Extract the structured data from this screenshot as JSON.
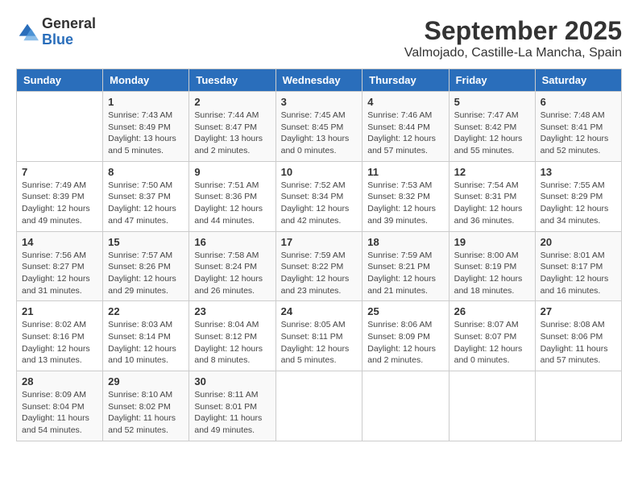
{
  "logo": {
    "general": "General",
    "blue": "Blue"
  },
  "header": {
    "month": "September 2025",
    "location": "Valmojado, Castille-La Mancha, Spain"
  },
  "days_of_week": [
    "Sunday",
    "Monday",
    "Tuesday",
    "Wednesday",
    "Thursday",
    "Friday",
    "Saturday"
  ],
  "weeks": [
    [
      {
        "num": "",
        "info": ""
      },
      {
        "num": "1",
        "info": "Sunrise: 7:43 AM\nSunset: 8:49 PM\nDaylight: 13 hours\nand 5 minutes."
      },
      {
        "num": "2",
        "info": "Sunrise: 7:44 AM\nSunset: 8:47 PM\nDaylight: 13 hours\nand 2 minutes."
      },
      {
        "num": "3",
        "info": "Sunrise: 7:45 AM\nSunset: 8:45 PM\nDaylight: 13 hours\nand 0 minutes."
      },
      {
        "num": "4",
        "info": "Sunrise: 7:46 AM\nSunset: 8:44 PM\nDaylight: 12 hours\nand 57 minutes."
      },
      {
        "num": "5",
        "info": "Sunrise: 7:47 AM\nSunset: 8:42 PM\nDaylight: 12 hours\nand 55 minutes."
      },
      {
        "num": "6",
        "info": "Sunrise: 7:48 AM\nSunset: 8:41 PM\nDaylight: 12 hours\nand 52 minutes."
      }
    ],
    [
      {
        "num": "7",
        "info": "Sunrise: 7:49 AM\nSunset: 8:39 PM\nDaylight: 12 hours\nand 49 minutes."
      },
      {
        "num": "8",
        "info": "Sunrise: 7:50 AM\nSunset: 8:37 PM\nDaylight: 12 hours\nand 47 minutes."
      },
      {
        "num": "9",
        "info": "Sunrise: 7:51 AM\nSunset: 8:36 PM\nDaylight: 12 hours\nand 44 minutes."
      },
      {
        "num": "10",
        "info": "Sunrise: 7:52 AM\nSunset: 8:34 PM\nDaylight: 12 hours\nand 42 minutes."
      },
      {
        "num": "11",
        "info": "Sunrise: 7:53 AM\nSunset: 8:32 PM\nDaylight: 12 hours\nand 39 minutes."
      },
      {
        "num": "12",
        "info": "Sunrise: 7:54 AM\nSunset: 8:31 PM\nDaylight: 12 hours\nand 36 minutes."
      },
      {
        "num": "13",
        "info": "Sunrise: 7:55 AM\nSunset: 8:29 PM\nDaylight: 12 hours\nand 34 minutes."
      }
    ],
    [
      {
        "num": "14",
        "info": "Sunrise: 7:56 AM\nSunset: 8:27 PM\nDaylight: 12 hours\nand 31 minutes."
      },
      {
        "num": "15",
        "info": "Sunrise: 7:57 AM\nSunset: 8:26 PM\nDaylight: 12 hours\nand 29 minutes."
      },
      {
        "num": "16",
        "info": "Sunrise: 7:58 AM\nSunset: 8:24 PM\nDaylight: 12 hours\nand 26 minutes."
      },
      {
        "num": "17",
        "info": "Sunrise: 7:59 AM\nSunset: 8:22 PM\nDaylight: 12 hours\nand 23 minutes."
      },
      {
        "num": "18",
        "info": "Sunrise: 7:59 AM\nSunset: 8:21 PM\nDaylight: 12 hours\nand 21 minutes."
      },
      {
        "num": "19",
        "info": "Sunrise: 8:00 AM\nSunset: 8:19 PM\nDaylight: 12 hours\nand 18 minutes."
      },
      {
        "num": "20",
        "info": "Sunrise: 8:01 AM\nSunset: 8:17 PM\nDaylight: 12 hours\nand 16 minutes."
      }
    ],
    [
      {
        "num": "21",
        "info": "Sunrise: 8:02 AM\nSunset: 8:16 PM\nDaylight: 12 hours\nand 13 minutes."
      },
      {
        "num": "22",
        "info": "Sunrise: 8:03 AM\nSunset: 8:14 PM\nDaylight: 12 hours\nand 10 minutes."
      },
      {
        "num": "23",
        "info": "Sunrise: 8:04 AM\nSunset: 8:12 PM\nDaylight: 12 hours\nand 8 minutes."
      },
      {
        "num": "24",
        "info": "Sunrise: 8:05 AM\nSunset: 8:11 PM\nDaylight: 12 hours\nand 5 minutes."
      },
      {
        "num": "25",
        "info": "Sunrise: 8:06 AM\nSunset: 8:09 PM\nDaylight: 12 hours\nand 2 minutes."
      },
      {
        "num": "26",
        "info": "Sunrise: 8:07 AM\nSunset: 8:07 PM\nDaylight: 12 hours\nand 0 minutes."
      },
      {
        "num": "27",
        "info": "Sunrise: 8:08 AM\nSunset: 8:06 PM\nDaylight: 11 hours\nand 57 minutes."
      }
    ],
    [
      {
        "num": "28",
        "info": "Sunrise: 8:09 AM\nSunset: 8:04 PM\nDaylight: 11 hours\nand 54 minutes."
      },
      {
        "num": "29",
        "info": "Sunrise: 8:10 AM\nSunset: 8:02 PM\nDaylight: 11 hours\nand 52 minutes."
      },
      {
        "num": "30",
        "info": "Sunrise: 8:11 AM\nSunset: 8:01 PM\nDaylight: 11 hours\nand 49 minutes."
      },
      {
        "num": "",
        "info": ""
      },
      {
        "num": "",
        "info": ""
      },
      {
        "num": "",
        "info": ""
      },
      {
        "num": "",
        "info": ""
      }
    ]
  ]
}
